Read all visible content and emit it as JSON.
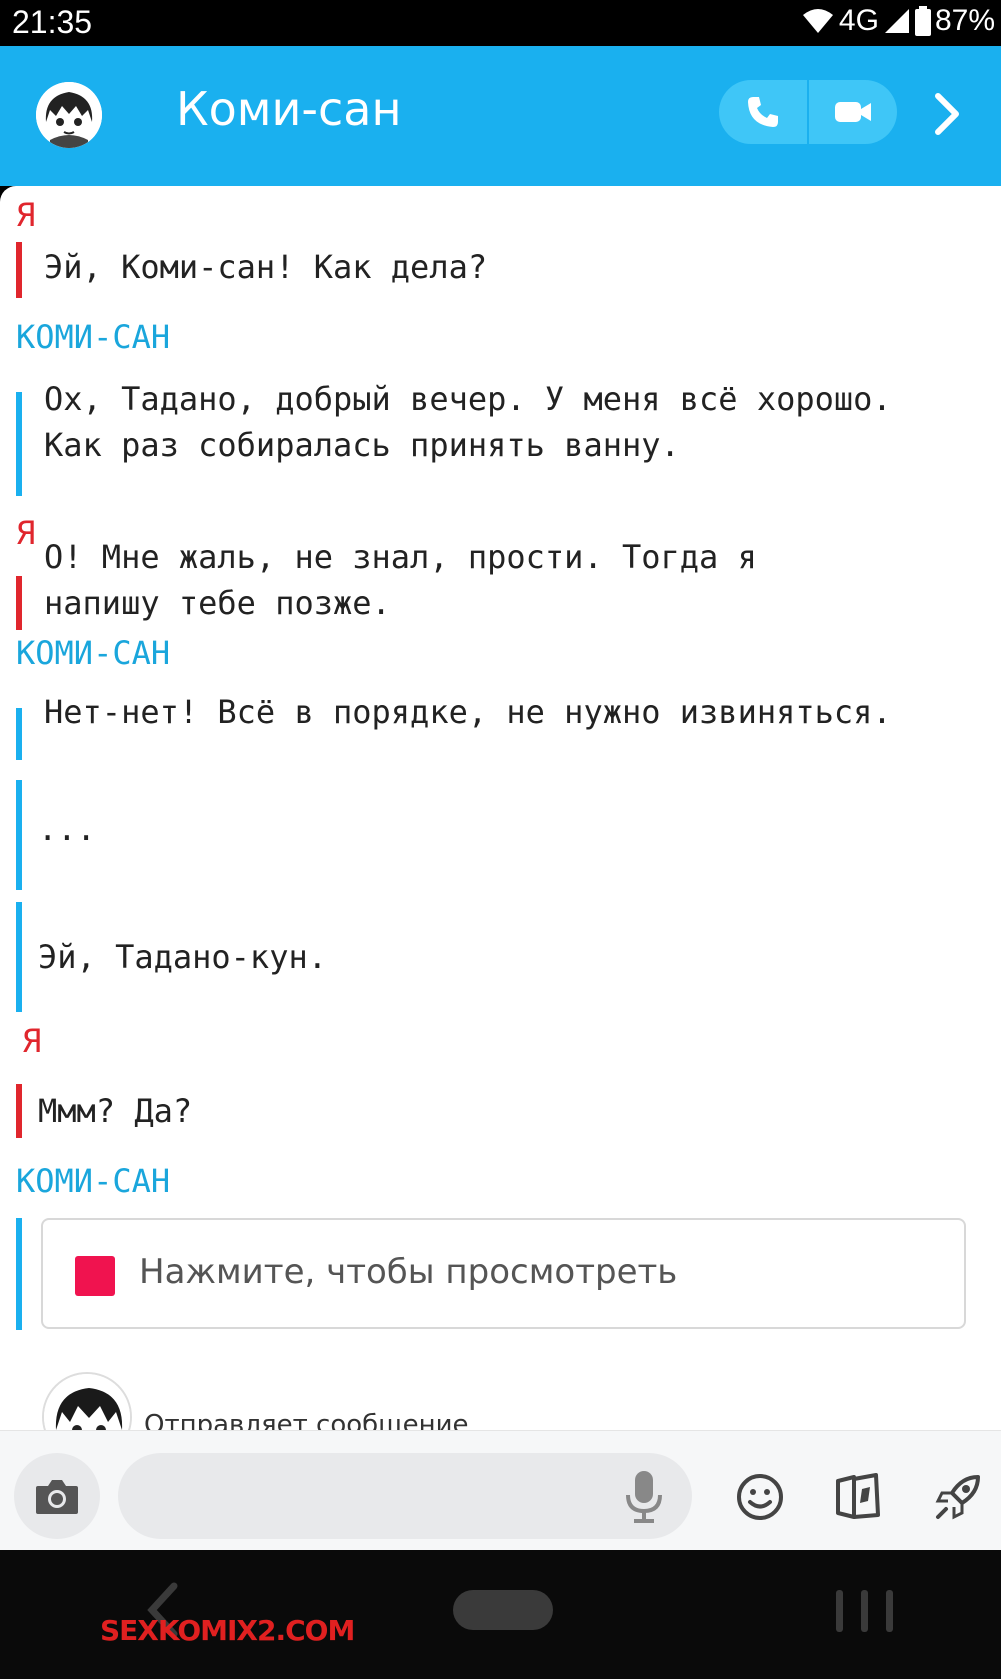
{
  "status": {
    "time": "21:35",
    "network": "4G",
    "battery": "87%"
  },
  "header": {
    "title": "Коми-сан"
  },
  "messages": [
    {
      "sender": "Я",
      "lines": [
        "Эй, Коми-сан! Как дела?"
      ]
    },
    {
      "sender": "КОМИ-САН",
      "lines": [
        "Ох, Тадано, добрый вечер. У меня всё хорошо.",
        "Как раз собиралась принять ванну."
      ]
    },
    {
      "sender": "Я",
      "lines": [
        "О! Мне жаль, не знал, прости. Тогда я",
        "напишу тебе позже."
      ]
    },
    {
      "sender": "КОМИ-САН",
      "lines": [
        "Нет-нет! Всё в порядке, не нужно извиняться."
      ]
    },
    {
      "sender": "",
      "lines": [
        "..."
      ]
    },
    {
      "sender": "",
      "lines": [
        "Эй, Тадано-кун."
      ]
    },
    {
      "sender": "Я",
      "lines": [
        "Ммм? Да?"
      ]
    },
    {
      "sender": "КОМИ-САН",
      "lines": []
    }
  ],
  "media_card": {
    "label": "Нажмите, чтобы просмотреть"
  },
  "typing": {
    "text": "Отправляет сообщение"
  },
  "input": {
    "placeholder": ""
  },
  "watermark": {
    "part1": "SEX",
    "part2": "KOMIX2.COM"
  },
  "colors": {
    "header": "#1ab0ef",
    "me": "#e0262d",
    "her": "#1aa6dc",
    "media_square": "#f0134f"
  },
  "icons": [
    "phone-icon",
    "video-camera-icon",
    "chevron-right-icon",
    "camera-icon",
    "microphone-icon",
    "emoji-icon",
    "sticker-icon",
    "rocket-icon",
    "back-icon",
    "home-icon",
    "recent-apps-icon"
  ]
}
